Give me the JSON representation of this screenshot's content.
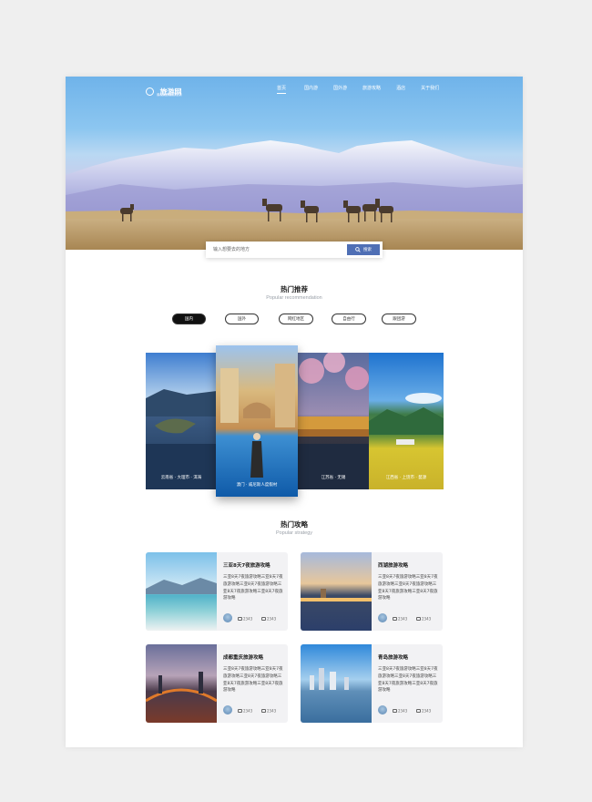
{
  "nav": {
    "logo_name": "旅游网",
    "logo_sub": "最权威的旅游服务",
    "items": [
      {
        "label": "首页",
        "active": true
      },
      {
        "label": "国内游",
        "active": false
      },
      {
        "label": "国外游",
        "active": false
      },
      {
        "label": "旅游攻略",
        "active": false
      },
      {
        "label": "酒店",
        "active": false
      },
      {
        "label": "关于我们",
        "active": false
      }
    ]
  },
  "search": {
    "placeholder": "输入想要去的地方",
    "button_label": "搜索"
  },
  "recommend": {
    "title": "热门推荐",
    "subtitle": "Popular recommendation",
    "tabs": [
      {
        "label": "国内",
        "active": true
      },
      {
        "label": "国外",
        "active": false
      },
      {
        "label": "网红地区",
        "active": false
      },
      {
        "label": "自由行",
        "active": false
      },
      {
        "label": "跟团游",
        "active": false
      }
    ],
    "cards": [
      {
        "label": "云南省 · 大理市 · 洱海"
      },
      {
        "label": "澳门 · 威尼斯人度假村"
      },
      {
        "label": "江苏省 · 无锡"
      },
      {
        "label": "江西省 · 上饶市 · 婺源"
      }
    ]
  },
  "strategy": {
    "title": "热门攻略",
    "subtitle": "Popular strategy",
    "items": [
      {
        "title": "三亚8天7夜旅游攻略",
        "desc": "三亚8天7夜旅游攻略三亚8天7夜旅游攻略三亚8天7夜旅游攻略三亚8天7夜旅游攻略三亚8天7夜旅游攻略",
        "likes": "2343",
        "comments": "2343"
      },
      {
        "title": "西湖旅游攻略",
        "desc": "三亚8天7夜旅游攻略三亚8天7夜旅游攻略三亚8天7夜旅游攻略三亚8天7夜旅游攻略三亚8天7夜旅游攻略",
        "likes": "2343",
        "comments": "2343"
      },
      {
        "title": "成都重庆旅游攻略",
        "desc": "三亚8天7夜旅游攻略三亚8天7夜旅游攻略三亚8天7夜旅游攻略三亚8天7夜旅游攻略三亚8天7夜旅游攻略",
        "likes": "2343",
        "comments": "2343"
      },
      {
        "title": "青岛旅游攻略",
        "desc": "三亚8天7夜旅游攻略三亚8天7夜旅游攻略三亚8天7夜旅游攻略三亚8天7夜旅游攻略三亚8天7夜旅游攻略",
        "likes": "2343",
        "comments": "2343"
      }
    ]
  },
  "colors": {
    "accent": "#4f6fb5",
    "tab_active": "#111111"
  }
}
